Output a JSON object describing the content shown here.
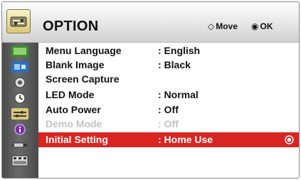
{
  "header": {
    "title": "OPTION",
    "move_hint": "Move",
    "ok_hint": "OK",
    "move_glyph": "◇",
    "ok_glyph": "◉"
  },
  "sidebar": {
    "tabs": [
      {
        "icon": "picture-icon"
      },
      {
        "icon": "audio-icon"
      },
      {
        "icon": "time-icon"
      },
      {
        "icon": "clock-icon"
      },
      {
        "icon": "option-icon",
        "active": true
      },
      {
        "icon": "info-icon"
      },
      {
        "icon": "input-icon"
      },
      {
        "icon": "scene-icon"
      }
    ]
  },
  "menu": {
    "rows": [
      {
        "label": "Menu Language",
        "value": ": English"
      },
      {
        "label": "Blank Image",
        "value": ": Black"
      },
      {
        "label": "Screen Capture",
        "value": ""
      },
      {
        "label": "LED Mode",
        "value": ": Normal"
      },
      {
        "label": "Auto Power",
        "value": ": Off"
      },
      {
        "label": "Demo Mode",
        "value": ": Off",
        "disabled": true
      },
      {
        "label": "Initial Setting",
        "value": ": Home Use",
        "selected": true
      }
    ]
  },
  "colors": {
    "selected_row": "#d92522",
    "disabled_text": "#c3c3c3",
    "sidebar_bg": "#555555"
  }
}
